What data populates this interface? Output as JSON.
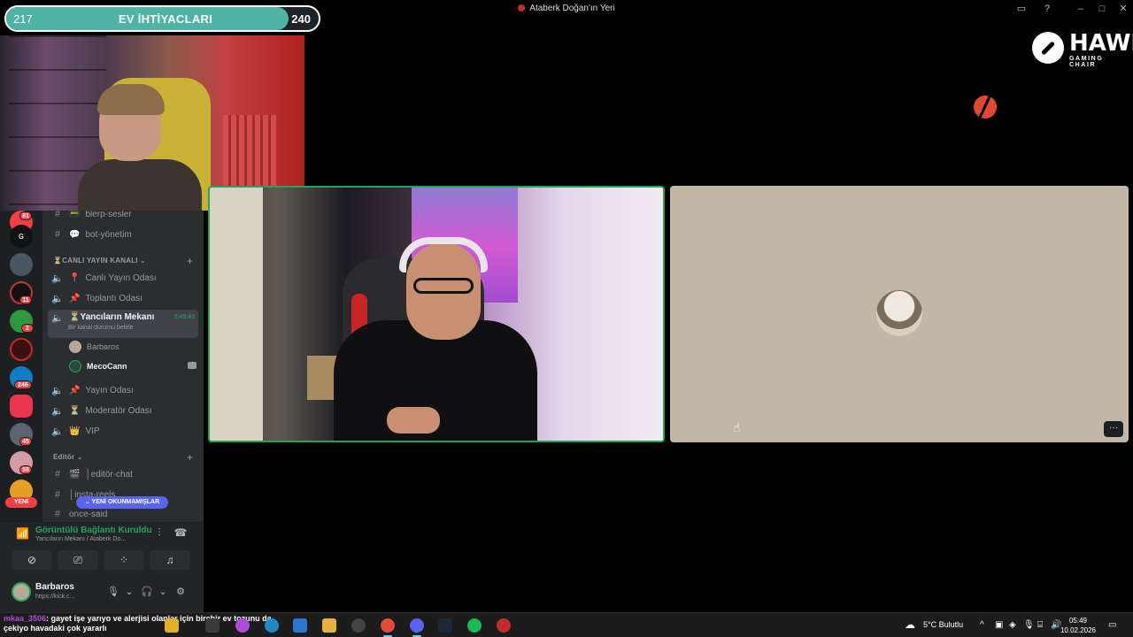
{
  "window": {
    "title": "Ataberk Doğan'ın Yeri"
  },
  "goal_bar": {
    "label": "EV İHTİYACLARI",
    "current": "217",
    "target": "240",
    "progress_fraction": 0.904,
    "color": "#4fb3a6"
  },
  "webcam_header": "Ataberk Doğan'ın Yeri",
  "server_badges": [
    "81",
    "11",
    "2",
    "246",
    "45",
    "58"
  ],
  "new_label": "YENİ",
  "channels": {
    "text": [
      {
        "icon": "📟",
        "name": "blerp-sesler"
      },
      {
        "icon": "💬",
        "name": "bot-yönetim"
      }
    ],
    "category_live": "⏳CANLI YAYIN KANALI",
    "voice_live": [
      {
        "icon": "📍",
        "name": "Canlı Yayın Odası"
      },
      {
        "icon": "📌",
        "name": "Toplantı Odası"
      }
    ],
    "active": {
      "name": "⏳Yancıların Mekanı",
      "sub": "Bir kanal durumu belirle",
      "timer": "3:49:43"
    },
    "members": [
      {
        "name": "Barbaros"
      },
      {
        "name": "MecoCann"
      }
    ],
    "voice_more": [
      {
        "icon": "📌",
        "name": "Yayın Odası"
      },
      {
        "icon": "⏳",
        "name": "Moderatör Odası"
      },
      {
        "icon": "👑",
        "name": "VIP"
      }
    ],
    "category_editor": "Editör",
    "editor": [
      {
        "icon": "🎬",
        "name": "│editör-chat"
      },
      {
        "icon": "",
        "name": "│insta-reels"
      },
      {
        "icon": "",
        "name": "once-said"
      }
    ],
    "unread_pill": "YENİ OKUNMAMIŞLAR"
  },
  "voice_panel": {
    "status": "Görüntülü Bağlantı Kuruldu",
    "where": "Yancıların Mekanı / Ataberk Do..."
  },
  "user_panel": {
    "name": "Barbaros",
    "status": "https://kick.c..."
  },
  "overlay_logo": {
    "big": "HAWK",
    "small": "GAMING CHAIR"
  },
  "chat_line": {
    "user": "mkaa_3506",
    "message": ": gayet işe yarıyo ve alerjisi olanlar için birebir ev tozunu da çekiyo havadaki çok yararlı"
  },
  "taskbar": {
    "weather": "5°C  Bulutlu",
    "time": "05:49",
    "date": "10.02.2026"
  }
}
